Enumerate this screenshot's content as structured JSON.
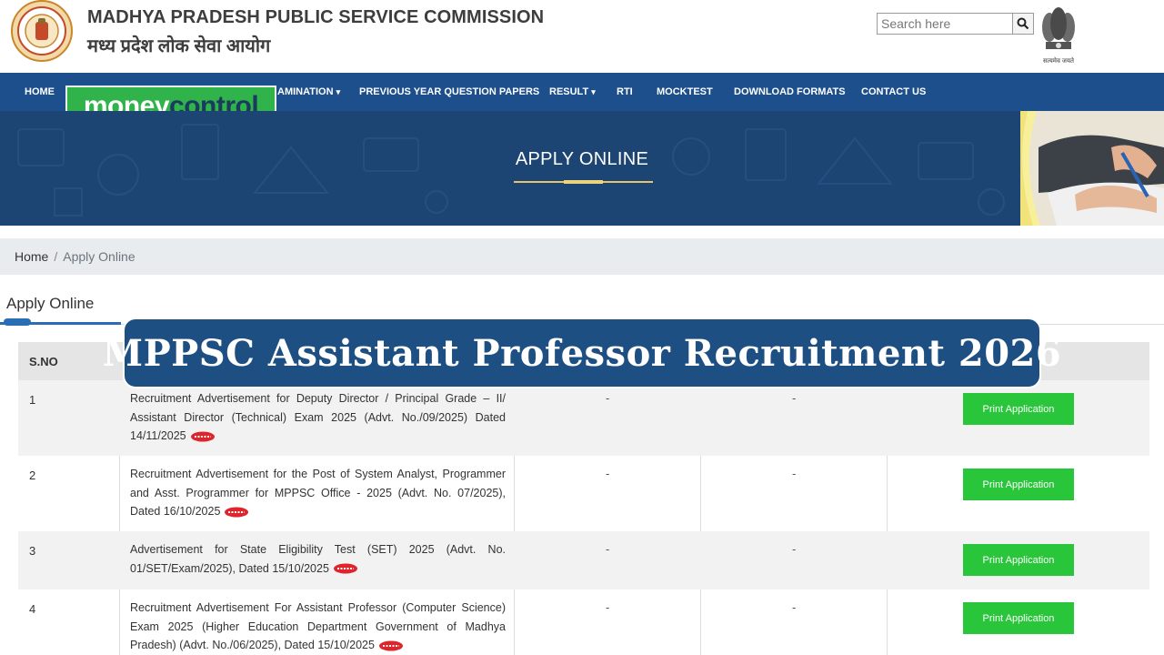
{
  "header": {
    "org_name_en": "MADHYA PRADESH PUBLIC SERVICE COMMISSION",
    "org_name_hi": "मध्य प्रदेश लोक सेवा आयोग",
    "search_placeholder": "Search here",
    "emblem_motto": "सत्यमेव जयते",
    "icons": [
      "mppsc-logo-icon",
      "search-icon",
      "state-emblem-icon"
    ]
  },
  "nav": {
    "items": [
      {
        "label": "HOME"
      },
      {
        "label": "AMINATION",
        "caret": "▾"
      },
      {
        "label": "PREVIOUS YEAR QUESTION PAPERS"
      },
      {
        "label": "RESULT",
        "caret": "▾"
      },
      {
        "label": "RTI"
      },
      {
        "label": "MOCKTEST"
      },
      {
        "label": "DOWNLOAD FORMATS"
      },
      {
        "label": "CONTACT US"
      }
    ]
  },
  "watermark": {
    "money": "money",
    "control": "control"
  },
  "banner": {
    "title": "APPLY ONLINE"
  },
  "breadcrumb": {
    "home": "Home",
    "separator": "/",
    "current": "Apply Online"
  },
  "section": {
    "title": "Apply Online"
  },
  "table": {
    "header_sno": "S.NO",
    "rows": [
      {
        "sno": "1",
        "description": "Recruitment Advertisement for Deputy Director / Principal Grade – II/ Assistant Director (Technical) Exam 2025 (Advt. No./09/2025) Dated 14/11/2025",
        "col3": "-",
        "col4": "-",
        "action": "Print Application"
      },
      {
        "sno": "2",
        "description": "Recruitment Advertisement for the Post of System Analyst, Programmer and Asst. Programmer for MPPSC Office - 2025 (Advt. No. 07/2025), Dated 16/10/2025",
        "col3": "-",
        "col4": "-",
        "action": "Print Application"
      },
      {
        "sno": "3",
        "description": "Advertisement for State Eligibility Test (SET) 2025 (Advt. No. 01/SET/Exam/2025), Dated 15/10/2025",
        "col3": "-",
        "col4": "-",
        "action": "Print Application"
      },
      {
        "sno": "4",
        "description": "Recruitment Advertisement For Assistant Professor (Computer Science) Exam 2025 (Higher Education Department Government of Madhya Pradesh) (Advt. No./06/2025), Dated 15/10/2025",
        "col3": "-",
        "col4": "-",
        "action": "Print Application"
      }
    ]
  },
  "overlay": {
    "title": "MPPSC Assistant Professor Recruitment 2026"
  },
  "colors": {
    "nav_bg": "#1c4f8c",
    "banner_bg": "#1d4573",
    "button_green": "#29c53b",
    "overlay_bg": "#1d4f82",
    "brand_green": "#2fb34a"
  }
}
